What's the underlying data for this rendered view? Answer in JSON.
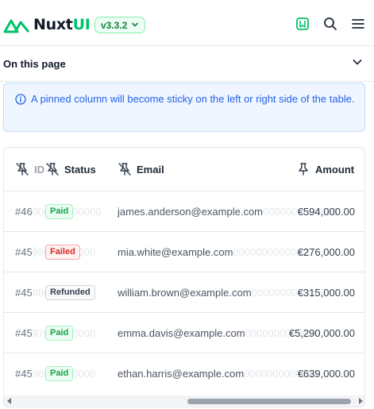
{
  "header": {
    "logo_text_main": "Nuxt",
    "logo_text_accent": "UI",
    "version": "v3.3.2",
    "colors": {
      "brand": "#00c16a",
      "text": "#111827"
    },
    "icons": [
      "nuxt-logo-icon",
      "chevron-down-icon",
      "book-open-icon",
      "search-icon",
      "menu-icon"
    ]
  },
  "on_this_page": {
    "label": "On this page"
  },
  "callout": {
    "icon": "info-icon",
    "text": "A pinned column will become sticky on the left or right side of the table."
  },
  "table": {
    "columns": [
      {
        "key": "id",
        "label": "ID",
        "pin_icon": "pin-off-icon"
      },
      {
        "key": "status",
        "label": "Status",
        "pin_icon": "pin-off-icon"
      },
      {
        "key": "email",
        "label": "Email",
        "pin_icon": "pin-off-icon"
      },
      {
        "key": "amount",
        "label": "Amount",
        "pin_icon": "pin-icon"
      }
    ],
    "rows": [
      {
        "id": "#46",
        "ghost_id": "000000000000",
        "status": "Paid",
        "status_type": "paid",
        "ghost_email": "0000000000000",
        "email": "james.anderson@example.com",
        "amount": "€594,000.00"
      },
      {
        "id": "#45",
        "ghost_id": "99000000000",
        "status": "Failed",
        "status_type": "failed",
        "ghost_email": "00000000000000",
        "email": "mia.white@example.com",
        "amount": "€276,000.00"
      },
      {
        "id": "#45",
        "ghost_id": "98000000000",
        "status": "Refunded",
        "status_type": "refunded",
        "ghost_email": "0000000000000",
        "email": "william.brown@example.com",
        "amount": "€315,000.00"
      },
      {
        "id": "#45",
        "ghost_id": "97000000000",
        "status": "Paid",
        "status_type": "paid",
        "ghost_email": "0000000000000",
        "email": "emma.davis@example.com",
        "amount": "€5,290,000.00"
      },
      {
        "id": "#45",
        "ghost_id": "96000000000",
        "status": "Paid",
        "status_type": "paid",
        "ghost_email": "0000000000000",
        "email": "ethan.harris@example.com",
        "amount": "€639,000.00"
      }
    ]
  }
}
